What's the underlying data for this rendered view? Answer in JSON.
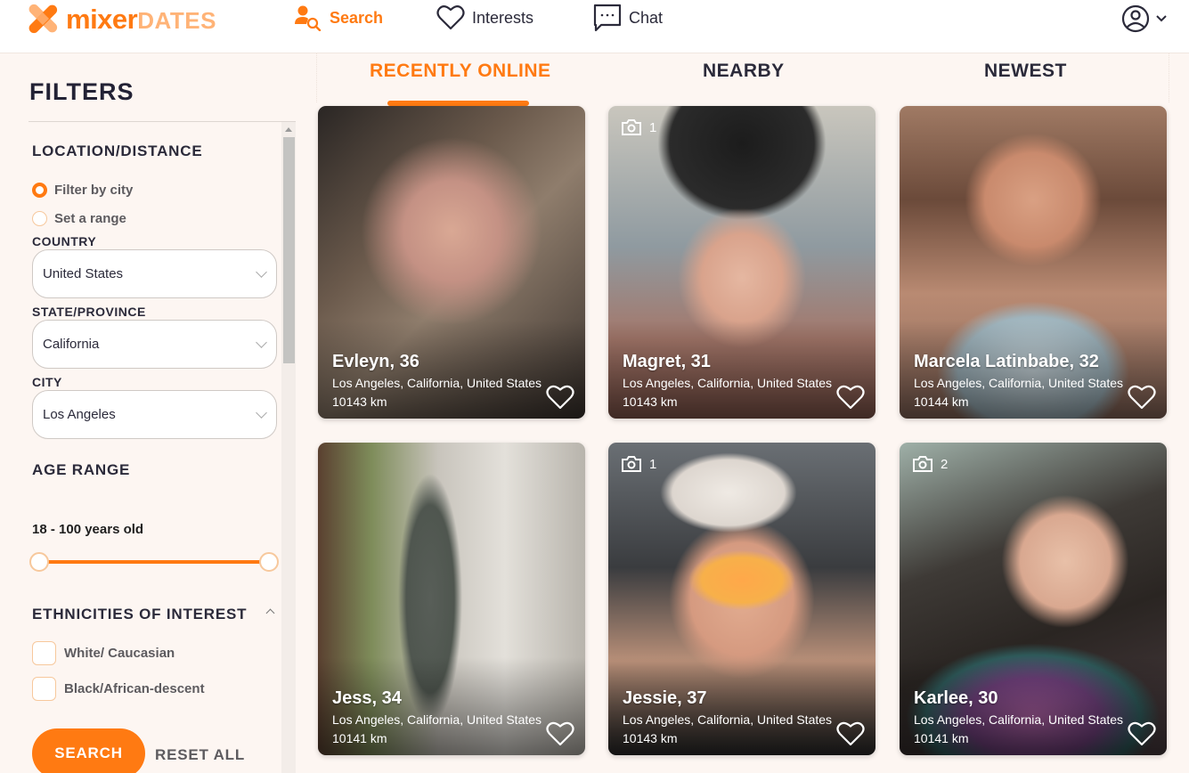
{
  "brand": {
    "name_part1": "mixer",
    "name_part2": "DATES",
    "accent_color": "#ff7a12",
    "accent_light": "#ffb377"
  },
  "nav": {
    "items": [
      {
        "label": "Search",
        "icon": "user-search-icon",
        "active": true
      },
      {
        "label": "Interests",
        "icon": "heart-icon",
        "active": false
      },
      {
        "label": "Chat",
        "icon": "chat-bubble-icon",
        "active": false
      }
    ],
    "account_icon": "user-circle-icon"
  },
  "sidebar": {
    "title": "FILTERS",
    "location": {
      "title": "LOCATION/DISTANCE",
      "options": [
        {
          "label": "Filter by city",
          "selected": true
        },
        {
          "label": "Set a range",
          "selected": false
        }
      ],
      "country": {
        "label": "COUNTRY",
        "value": "United States"
      },
      "state": {
        "label": "STATE/PROVINCE",
        "value": "California"
      },
      "city": {
        "label": "CITY",
        "value": "Los Angeles"
      }
    },
    "age": {
      "title": "AGE RANGE",
      "summary": "18 - 100 years old",
      "min": 18,
      "max": 100
    },
    "ethnicities": {
      "title": "ETHNICITIES OF INTEREST",
      "options": [
        {
          "label": "White/ Caucasian",
          "checked": false
        },
        {
          "label": "Black/African-descent",
          "checked": false
        }
      ]
    },
    "search_button": "SEARCH",
    "reset_button": "RESET ALL"
  },
  "tabs": [
    {
      "label": "RECENTLY ONLINE",
      "active": true
    },
    {
      "label": "NEARBY",
      "active": false
    },
    {
      "label": "NEWEST",
      "active": false
    }
  ],
  "profiles": [
    {
      "name": "Evleyn, 36",
      "location": "Los Angeles, California, United States",
      "distance": "10143 km",
      "photo_count": null
    },
    {
      "name": "Magret, 31",
      "location": "Los Angeles, California, United States",
      "distance": "10143 km",
      "photo_count": "1"
    },
    {
      "name": "Marcela Latinbabe, 32",
      "location": "Los Angeles, California, United States",
      "distance": "10144 km",
      "photo_count": null
    },
    {
      "name": "Jess, 34",
      "location": "Los Angeles, California, United States",
      "distance": "10141 km",
      "photo_count": null
    },
    {
      "name": "Jessie, 37",
      "location": "Los Angeles, California, United States",
      "distance": "10143 km",
      "photo_count": "1"
    },
    {
      "name": "Karlee, 30",
      "location": "Los Angeles, California, United States",
      "distance": "10141 km",
      "photo_count": "2"
    }
  ]
}
